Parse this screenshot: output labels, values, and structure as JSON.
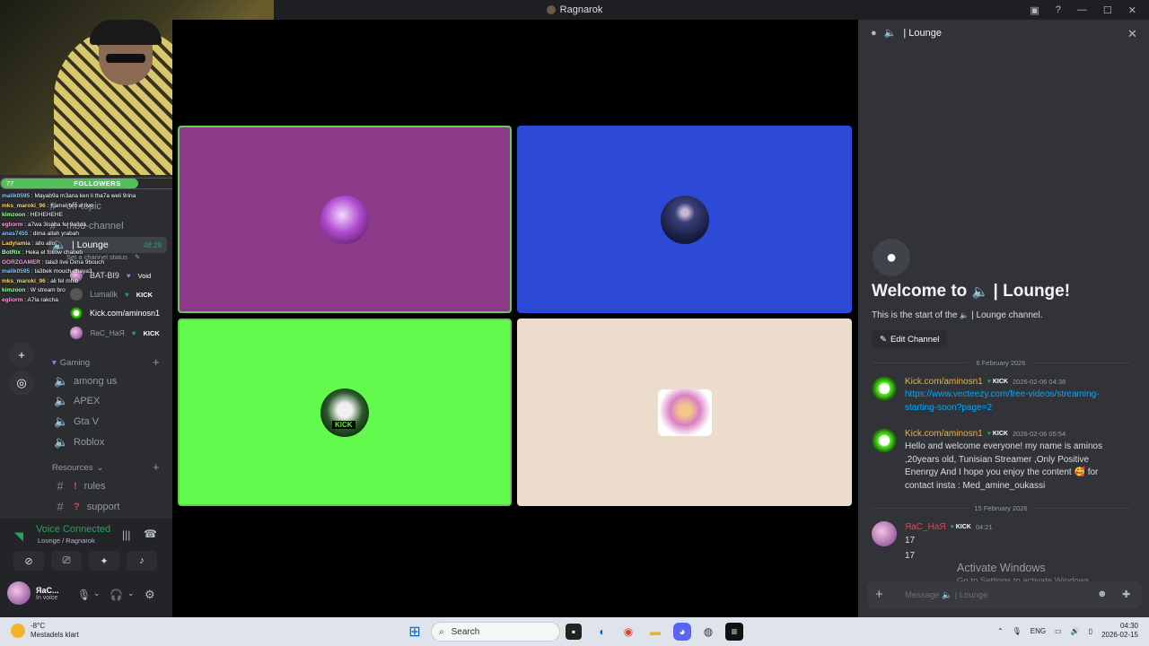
{
  "window": {
    "title": "Ragnarok"
  },
  "webcam_overlay": {
    "followers_label": "FOLLOWERS",
    "followers_current": "77",
    "followers_goal": "100",
    "followers_fraction": 0.72,
    "chat": [
      {
        "user": "malik0595",
        "text": "Mayab9a m3ana ken li tha7a weli 9rina"
      },
      {
        "user": "mks_maroki_96",
        "text": "Kamel bro w live"
      },
      {
        "user": "kimzoon",
        "text": "HEHEHEHE"
      },
      {
        "user": "egliorm",
        "text": "a7wa 3isaba fel 9a3da"
      },
      {
        "user": "anas7455",
        "text": "dima allah yrabah"
      },
      {
        "user": "Ladylamia",
        "text": "allo allo"
      },
      {
        "user": "BotRix",
        "text": "Heka el follow chabeb"
      },
      {
        "user": "GORZGAMER",
        "text": "tala3 live Dima 9bouch"
      },
      {
        "user": "malik0595",
        "text": "ta3bek mouch dhaya3"
      },
      {
        "user": "mks_maroki_96",
        "text": "ali fel mhib"
      },
      {
        "user": "kimzoon",
        "text": "W stream bro"
      },
      {
        "user": "egliorm",
        "text": "A7la rakcha"
      }
    ]
  },
  "sidebar": {
    "channels_top": [
      {
        "name": "off-topic",
        "icon": "#"
      },
      {
        "name": "mod-channel",
        "icon": "#"
      }
    ],
    "active_voice": {
      "name": "| Lounge",
      "timer": "48:29",
      "status": "Set a channel status"
    },
    "voice_users": [
      {
        "name": "BAT-BI9",
        "badge": "Void"
      },
      {
        "name": "Lumalik",
        "badge": "KICK"
      },
      {
        "name": "Kick.com/aminosn1",
        "badge": ""
      },
      {
        "name": "ЯaC_НaЯ",
        "badge": "KICK"
      }
    ],
    "categories": [
      {
        "name": "Gaming",
        "channels": [
          "among us",
          "APEX",
          "Gta V",
          "Roblox"
        ]
      },
      {
        "name": "Resources",
        "channels": [
          "rules",
          "support"
        ]
      }
    ],
    "resource_prefixes": [
      "!",
      "?"
    ],
    "voice_connected": {
      "title": "Voice Connected",
      "subtitle": "Lounge / Ragnarok"
    },
    "user": {
      "name": "ЯaC...",
      "status": "In voice"
    }
  },
  "stage": {
    "tiles": [
      {
        "name": "tile-1",
        "color": "#8e3a8a",
        "border": "#5fd14a"
      },
      {
        "name": "tile-2",
        "color": "#2c4ad6",
        "border": "none"
      },
      {
        "name": "tile-3",
        "color": "#63fa4e",
        "border": "#5fd14a"
      },
      {
        "name": "tile-4",
        "color": "#ebdccb",
        "border": "none"
      }
    ],
    "kick_label": "KICK"
  },
  "panel": {
    "header": "| Lounge",
    "welcome_prefix": "Welcome to",
    "welcome_channel": "| Lounge!",
    "start_text": "This is the start of the",
    "start_channel": "| Lounge channel.",
    "edit_channel": "Edit Channel",
    "date1": "6 February 2026",
    "date2": "15 February 2026",
    "messages": [
      {
        "author": "Kick.com/aminosn1",
        "badge": "KICK",
        "time": "2026-02-06 04:38",
        "link": "https://www.vecteezy.com/free-videos/streaming-starting-soon?page=2"
      },
      {
        "author": "Kick.com/aminosn1",
        "badge": "KICK",
        "time": "2026-02-06 05:54",
        "text": "Hello and welcome everyone! my name is aminos ,20years old, Tunisian Streamer ,Only Positive Enenrgy And I hope you enjoy the content 🥰 for contact insta : Med_amine_oukassi"
      },
      {
        "author": "ЯaC_НaЯ",
        "badge": "KICK",
        "time": "04:21",
        "lines": [
          "17",
          "17"
        ]
      }
    ],
    "input_placeholder": "Message 🔈 | Lounge"
  },
  "watermark": {
    "title": "Activate Windows",
    "subtitle": "Go to Settings to activate Windows."
  },
  "taskbar": {
    "weather_temp": "-8°C",
    "weather_desc": "Mestadels klart",
    "search": "Search",
    "lang": "ENG",
    "time": "04:30",
    "date": "2026-02-15"
  },
  "colors": {
    "accent": "#23a55a",
    "kick": "#53fc18",
    "author": "#f0b232",
    "link": "#00a8fc"
  }
}
